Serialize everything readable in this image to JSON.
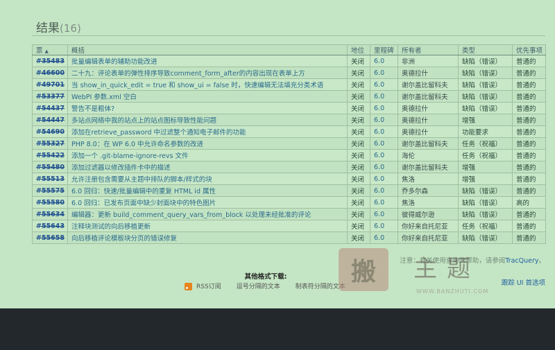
{
  "results": {
    "heading": "结果",
    "count": "(16)"
  },
  "columns": {
    "id": "票",
    "sort_arrow": "▲",
    "summary": "概括",
    "status": "地位",
    "milestone": "里程碑",
    "owner": "所有者",
    "type": "类型",
    "priority": "优先事项"
  },
  "tickets": [
    {
      "id": "#35483",
      "summary": "批量编辑表单的辅助功能改进",
      "status": "关闭",
      "milestone": "6.0",
      "owner": "非洲",
      "type": "缺陷（错误）",
      "priority": "普通的"
    },
    {
      "id": "#46600",
      "summary": "二十九：评论表单的弹性排序导致comment_form_after的内容出现在表单上方",
      "status": "关闭",
      "milestone": "6.0",
      "owner": "奥德拉什",
      "type": "缺陷（错误）",
      "priority": "普通的"
    },
    {
      "id": "#49701",
      "summary": "当 show_in_quick_edit = true 和 show_ui = false 时，快速编辑无法填充分类术语",
      "status": "关闭",
      "milestone": "6.0",
      "owner": "谢尔盖比留科夫",
      "type": "缺陷（错误）",
      "priority": "普通的"
    },
    {
      "id": "#53377",
      "summary": "WebPI 参数.xml 空白",
      "status": "关闭",
      "milestone": "6.0",
      "owner": "谢尔盖比留科夫",
      "type": "缺陷（错误）",
      "priority": "普通的"
    },
    {
      "id": "#54437",
      "summary": "警告不是粗体?",
      "status": "关闭",
      "milestone": "6.0",
      "owner": "奥德拉什",
      "type": "缺陷（错误）",
      "priority": "普通的"
    },
    {
      "id": "#54447",
      "summary": "多站点网络中我的站点上的站点图标导致性能问题",
      "status": "关闭",
      "milestone": "6.0",
      "owner": "奥德拉什",
      "type": "增强",
      "priority": "普通的"
    },
    {
      "id": "#54690",
      "summary": "添加在retrieve_password 中过滤整个通知电子邮件的功能",
      "status": "关闭",
      "milestone": "6.0",
      "owner": "奥德拉什",
      "type": "功能要求",
      "priority": "普通的"
    },
    {
      "id": "#55327",
      "summary": "PHP 8.0：在 WP 6.0 中允许命名参数的改进",
      "status": "关闭",
      "milestone": "6.0",
      "owner": "谢尔盖比留科夫",
      "type": "任务（祝福）",
      "priority": "普通的"
    },
    {
      "id": "#55422",
      "summary": "添加一个 .git-blame-ignore-revs 文件",
      "status": "关闭",
      "milestone": "6.0",
      "owner": "海伦",
      "type": "任务（祝福）",
      "priority": "普通的"
    },
    {
      "id": "#55480",
      "summary": "添加过滤器以修改插件卡中的描述",
      "status": "关闭",
      "milestone": "6.0",
      "owner": "谢尔盖比留科夫",
      "type": "增强",
      "priority": "普通的"
    },
    {
      "id": "#55513",
      "summary": "允许注册包含需要从主题中排队的脚本/样式的块",
      "status": "关闭",
      "milestone": "6.0",
      "owner": "焦洛",
      "type": "增强",
      "priority": "普通的"
    },
    {
      "id": "#55575",
      "summary": "6.0 回归：快速/批量编辑中的重复 HTML id 属性",
      "status": "关闭",
      "milestone": "6.0",
      "owner": "乔多尔森",
      "type": "缺陷（错误）",
      "priority": "普通的"
    },
    {
      "id": "#55580",
      "summary": "6.0 回归：已发布页面中缺少封面块中的特色图片",
      "status": "关闭",
      "milestone": "6.0",
      "owner": "焦洛",
      "type": "缺陷（错误）",
      "priority": "高的"
    },
    {
      "id": "#55634",
      "summary": "编辑器：更新 build_comment_query_vars_from_block 以处理未经批准的评论",
      "status": "关闭",
      "milestone": "6.0",
      "owner": "彼得威尔逊",
      "type": "缺陷（错误）",
      "priority": "普通的"
    },
    {
      "id": "#55643",
      "summary": "注释块测试的向后移植更新",
      "status": "关闭",
      "milestone": "6.0",
      "owner": "你好来自托尼亚",
      "type": "任务（祝福）",
      "priority": "普通的"
    },
    {
      "id": "#55658",
      "summary": "向后移植评论模板块分页的错误修复",
      "status": "关闭",
      "milestone": "6.0",
      "owner": "你好来自托尼亚",
      "type": "缺陷（错误）",
      "priority": "普通的"
    }
  ],
  "note": {
    "prefix": "注意：有关使用查询的帮助，请参阅",
    "link": "TracQuery",
    "suffix": "。"
  },
  "formats": {
    "title": "其他格式下载:",
    "rss": "RSS订阅",
    "csv": "逗号分隔的文本",
    "tsv": "制表符分隔的文本"
  },
  "track_link": "跟踪 UI 首选项",
  "watermark": {
    "glyph": "搬",
    "title": "主题",
    "url": "WWW.BANZHUTI.COM"
  },
  "colors": {
    "page_bg": "#c5e6c5",
    "footer_bg": "#23282d",
    "link": "#1f4f8f"
  }
}
